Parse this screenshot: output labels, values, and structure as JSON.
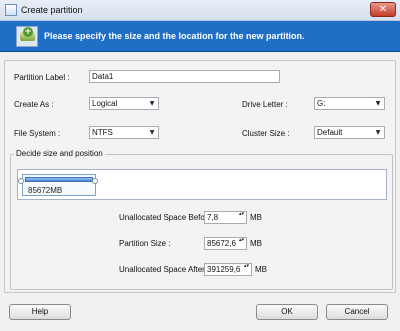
{
  "window": {
    "title": "Create partition",
    "close_glyph": "✕"
  },
  "banner": {
    "text": "Please specify the size and the location for the new partition.",
    "icon": "add-partition-icon"
  },
  "form": {
    "partition_label": {
      "label": "Partition Label :",
      "value": "Data1"
    },
    "create_as": {
      "label": "Create As :",
      "value": "Logical"
    },
    "drive_letter": {
      "label": "Drive Letter :",
      "value": "G:"
    },
    "file_system": {
      "label": "File System :",
      "value": "NTFS"
    },
    "cluster_size": {
      "label": "Cluster Size :",
      "value": "Default"
    }
  },
  "decide": {
    "legend": "Decide size and position",
    "partition_size_text": "85672MB",
    "before": {
      "label": "Unallocated Space Before:",
      "value": "7,8",
      "unit": "MB"
    },
    "size": {
      "label": "Partition Size :",
      "value": "85672,6",
      "unit": "MB"
    },
    "after": {
      "label": "Unallocated Space After:",
      "value": "391259,6",
      "unit": "MB"
    }
  },
  "buttons": {
    "help": "Help",
    "ok": "OK",
    "cancel": "Cancel"
  },
  "arrow_glyph": "▼",
  "spin_glyph": "▴▾"
}
